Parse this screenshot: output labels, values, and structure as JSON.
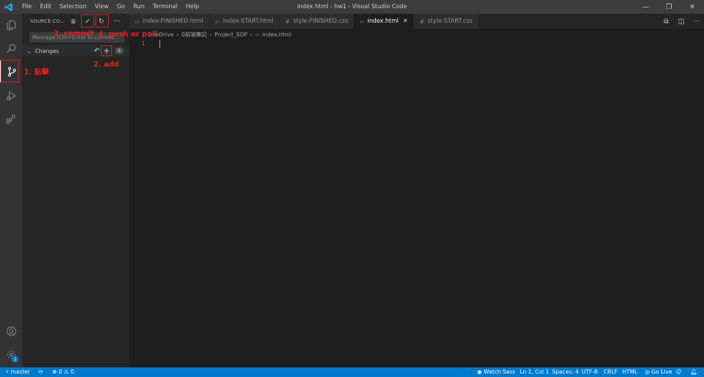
{
  "window": {
    "title": "index.html - hw1 - Visual Studio Code",
    "menu": [
      "File",
      "Edit",
      "Selection",
      "View",
      "Go",
      "Run",
      "Terminal",
      "Help"
    ]
  },
  "sidebar": {
    "title": "SOURCE CO...",
    "message_placeholder": "Message (Ctrl+Enter to commit...",
    "changes_label": "Changes",
    "changes_count": "0"
  },
  "tabs": [
    {
      "label": "index-FINISHED.html",
      "kind": "html",
      "active": false
    },
    {
      "label": "index-START.html",
      "kind": "html",
      "active": false
    },
    {
      "label": "style-FINISHED.css",
      "kind": "css",
      "active": false
    },
    {
      "label": "index.html",
      "kind": "html",
      "active": true
    },
    {
      "label": "style-START.css",
      "kind": "css",
      "active": false
    }
  ],
  "breadcrumb": [
    "OneDrive",
    "0前端筆記",
    "Project_SOP",
    "index.html"
  ],
  "editor": {
    "line_number": "1"
  },
  "statusbar": {
    "branch": "master",
    "problems": "0",
    "warnings": "0",
    "watch_sass": "Watch Sass",
    "position": "Ln 1, Col 1",
    "spaces": "Spaces: 4",
    "encoding": "UTF-8",
    "eol": "CRLF",
    "language": "HTML",
    "go_live": "Go Live"
  },
  "activity_badge": "1",
  "annotations": {
    "click": "1. 點擊",
    "add": "2. add",
    "commit": "3. commit",
    "push_pull": "4. push or pull"
  },
  "colors": {
    "accent": "#007acc",
    "annotation": "#e02020",
    "html_icon": "#e37933",
    "css_icon": "#519aba"
  }
}
